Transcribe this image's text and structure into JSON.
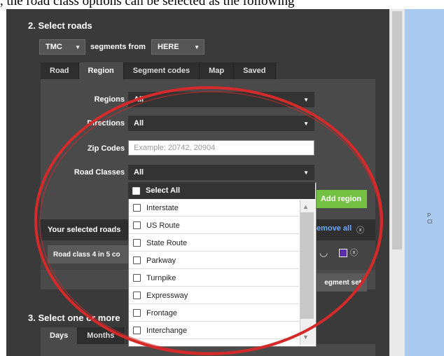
{
  "caption": ", the road class options can be selected as the following",
  "section2": {
    "title": "2. Select roads",
    "source_type": "TMC",
    "segments_from_label": "segments from",
    "provider": "HERE",
    "tabs": [
      "Road",
      "Region",
      "Segment codes",
      "Map",
      "Saved"
    ],
    "active_tab": "Region"
  },
  "form": {
    "regions_label": "Regions",
    "regions_value": "All",
    "directions_label": "Directions",
    "directions_value": "All",
    "zip_label": "Zip Codes",
    "zip_placeholder": "Example: 20742, 20904",
    "road_classes_label": "Road Classes",
    "road_classes_value": "All",
    "add_region_label": "Add region"
  },
  "road_class_dropdown": {
    "select_all": "Select All",
    "options": [
      "Interstate",
      "US Route",
      "State Route",
      "Parkway",
      "Turnpike",
      "Expressway",
      "Frontage",
      "Interchange"
    ]
  },
  "selected": {
    "header": "Your selected roads",
    "remove_all": "emove all",
    "chip": "Road class 4 in 5 co",
    "segment_set_button": "egment set"
  },
  "section3": {
    "title": "3. Select one or more",
    "tabs": [
      "Days",
      "Months"
    ]
  },
  "map_text": "P\nCl",
  "annotation_color": "#d42a2a"
}
